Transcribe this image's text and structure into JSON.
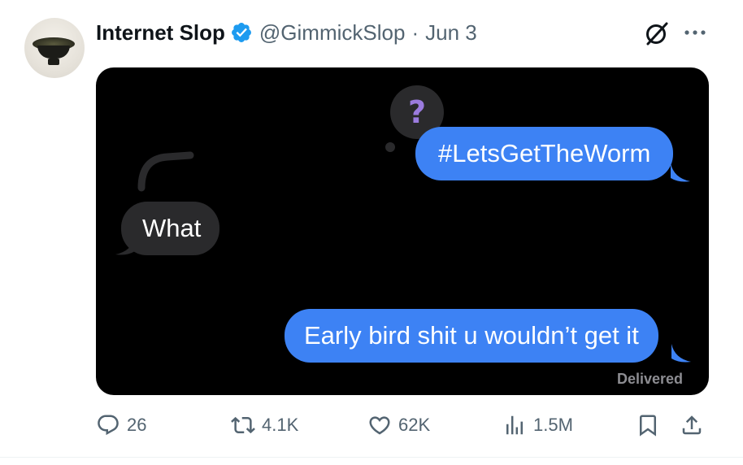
{
  "author": {
    "name": "Internet Slop",
    "handle": "@GimmickSlop",
    "separator": "·",
    "date": "Jun 3",
    "verified_color": "#1d9bf0"
  },
  "header_icons": [
    "grok-icon",
    "more-icon"
  ],
  "media": {
    "thought_symbol": "?",
    "messages": [
      {
        "side": "right",
        "text": "#LetsGetTheWorm"
      },
      {
        "side": "left",
        "text": "What"
      },
      {
        "side": "right",
        "text": "Early bird shit u wouldn’t get it"
      }
    ],
    "status": "Delivered",
    "colors": {
      "sent": "#3d82f4",
      "received": "#2a2a2c",
      "background": "#000000"
    }
  },
  "actions": {
    "replies": "26",
    "reposts": "4.1K",
    "likes": "62K",
    "views": "1.5M"
  }
}
